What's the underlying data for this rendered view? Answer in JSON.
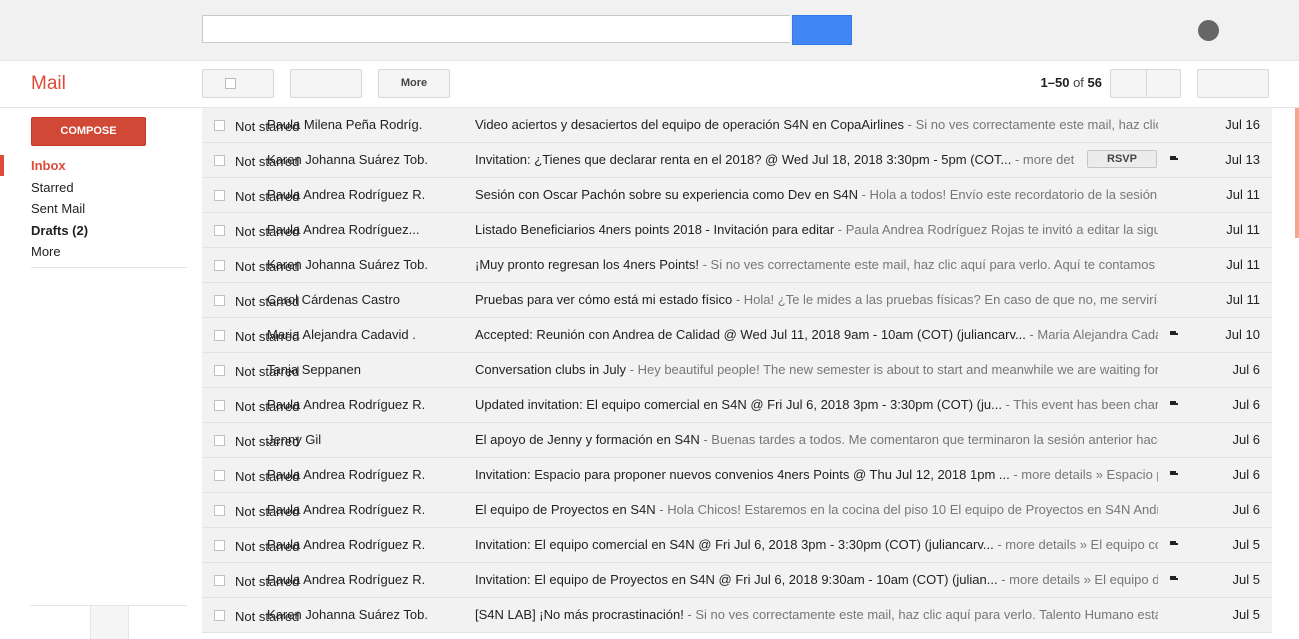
{
  "header": {
    "search_placeholder": "",
    "search_button_label": ""
  },
  "toolbar": {
    "mail_label": "Mail",
    "more_label": "More",
    "pager_range": "1–50",
    "pager_of": "of",
    "pager_total": "56"
  },
  "compose_label": "COMPOSE",
  "nav": [
    {
      "label": "Inbox",
      "active": true
    },
    {
      "label": "Starred"
    },
    {
      "label": "Sent Mail"
    },
    {
      "label": "Drafts (2)",
      "bold": true
    },
    {
      "label": "More"
    }
  ],
  "star_label": "Not starred",
  "rsvp_label": "RSVP",
  "messages": [
    {
      "sender": "Paula Milena Peña Rodríg.",
      "subject": "Video aciertos y desaciertos del equipo de operación S4N en CopaAirlines",
      "snippet": " - Si no ves correctamente este mail, haz clic",
      "date": "Jul 16"
    },
    {
      "sender": "Karen Johanna Suárez Tob.",
      "subject": "Invitation: ¿Tienes que declarar renta en el 2018? @ Wed Jul 18, 2018 3:30pm - 5pm (COT...",
      "snippet": " - more det",
      "date": "Jul 13",
      "rsvp": true,
      "calendar": true
    },
    {
      "sender": "Paula Andrea Rodríguez R.",
      "subject": "Sesión con Oscar Pachón sobre su experiencia como Dev en S4N",
      "snippet": " - Hola a todos! Envío este recordatorio de la sesión c",
      "date": "Jul 11"
    },
    {
      "sender": "Paula Andrea Rodríguez...",
      "subject": "Listado Beneficiarios 4ners points 2018 - Invitación para editar",
      "snippet": " - Paula Andrea Rodríguez Rojas te invitó a editar la sigui",
      "date": "Jul 11"
    },
    {
      "sender": "Karen Johanna Suárez Tob.",
      "subject": "¡Muy pronto regresan los 4ners Points!",
      "snippet": " - Si no ves correctamente este mail, haz clic aquí para verlo. Aquí te contamos e",
      "date": "Jul 11"
    },
    {
      "sender": "Carol Cárdenas Castro",
      "subject": "Pruebas para ver cómo está mi estado físico",
      "snippet": " - Hola! ¿Te le mides a las pruebas físicas? En caso de que no, me serviría",
      "date": "Jul 11"
    },
    {
      "sender": "Maria Alejandra Cadavid .",
      "subject": "Accepted: Reunión con Andrea de Calidad @ Wed Jul 11, 2018 9am - 10am (COT) (juliancarv...",
      "snippet": " - Maria Alejandra Cada",
      "date": "Jul 10",
      "calendar": true
    },
    {
      "sender": "Tanja Seppanen",
      "subject": "Conversation clubs in July",
      "snippet": " - Hey beautiful people! The new semester is about to start and meanwhile we are waiting for a",
      "date": "Jul 6"
    },
    {
      "sender": "Paula Andrea Rodríguez R.",
      "subject": "Updated invitation: El equipo comercial en S4N @ Fri Jul 6, 2018 3pm - 3:30pm (COT) (ju...",
      "snippet": " - This event has been chan",
      "date": "Jul 6",
      "calendar": true
    },
    {
      "sender": "Jenny Gil",
      "subject": "El apoyo de Jenny y formación en S4N",
      "snippet": " - Buenas tardes a todos. Me comentaron que terminaron la sesión anterior hace",
      "date": "Jul 6"
    },
    {
      "sender": "Paula Andrea Rodríguez R.",
      "subject": "Invitation: Espacio para proponer nuevos convenios 4ners Points @ Thu Jul 12, 2018 1pm ...",
      "snippet": " - more details » Espacio p",
      "date": "Jul 6",
      "calendar": true
    },
    {
      "sender": "Paula Andrea Rodríguez R.",
      "subject": "El equipo de Proyectos en S4N",
      "snippet": " - Hola Chicos! Estaremos en la cocina del piso 10 El equipo de Proyectos en S4N Andr",
      "date": "Jul 6"
    },
    {
      "sender": "Paula Andrea Rodríguez R.",
      "subject": "Invitation: El equipo comercial en S4N @ Fri Jul 6, 2018 3pm - 3:30pm (COT) (juliancarv...",
      "snippet": " - more details » El equipo co",
      "date": "Jul 5",
      "calendar": true
    },
    {
      "sender": "Paula Andrea Rodríguez R.",
      "subject": "Invitation: El equipo de Proyectos en S4N @ Fri Jul 6, 2018 9:30am - 10am (COT) (julian...",
      "snippet": " - more details » El equipo d",
      "date": "Jul 5",
      "calendar": true
    },
    {
      "sender": "Karen Johanna Suárez Tob.",
      "subject": "[S4N LAB] ¡No más procrastinación!",
      "snippet": " - Si no ves correctamente este mail, haz clic aquí para verlo. Talento Humano está",
      "date": "Jul 5"
    }
  ],
  "colors": {
    "accent_red": "#dd4b39",
    "compose_red": "#d14836",
    "search_blue": "#4285f4"
  }
}
